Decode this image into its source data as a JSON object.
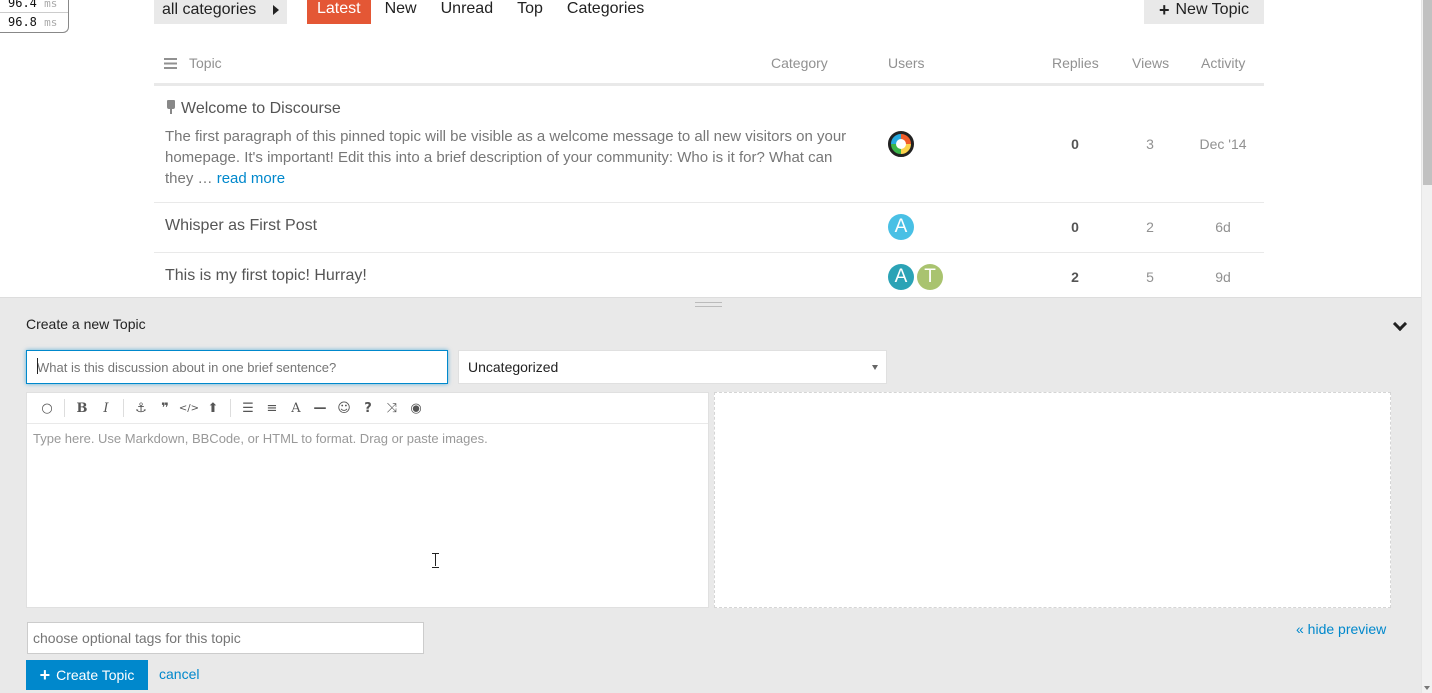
{
  "profiler": [
    {
      "value": "96.4",
      "unit": "ms"
    },
    {
      "value": "96.8",
      "unit": "ms"
    }
  ],
  "nav": {
    "category_dropdown": "all categories",
    "tabs": [
      "Latest",
      "New",
      "Unread",
      "Top",
      "Categories"
    ],
    "active_tab": "Latest",
    "new_topic_label": "New Topic"
  },
  "table": {
    "headers": {
      "topic": "Topic",
      "category": "Category",
      "users": "Users",
      "replies": "Replies",
      "views": "Views",
      "activity": "Activity"
    },
    "rows": [
      {
        "title": "Welcome to Discourse",
        "pinned": true,
        "excerpt": "The first paragraph of this pinned topic will be visible as a welcome message to all new visitors on your homepage. It's important! Edit this into a brief description of your community: Who is it for? What can they …",
        "read_more": "read more",
        "users": [
          "discourse-logo"
        ],
        "replies": "0",
        "views": "3",
        "activity": "Dec '14"
      },
      {
        "title": "Whisper as First Post",
        "users": [
          "A"
        ],
        "replies": "0",
        "views": "2",
        "activity": "6d"
      },
      {
        "title": "This is my first topic! Hurray!",
        "users": [
          "A",
          "T"
        ],
        "replies": "2",
        "views": "5",
        "activity": "9d"
      }
    ]
  },
  "composer": {
    "heading": "Create a new Topic",
    "title_placeholder": "What is this discussion about in one brief sentence?",
    "category": "Uncategorized",
    "editor_placeholder": "Type here. Use Markdown, BBCode, or HTML to format. Drag or paste images.",
    "toolbar_icons": [
      "speech-bubble-icon",
      "bold-icon",
      "italic-icon",
      "link-icon",
      "quote-icon",
      "code-icon",
      "upload-icon",
      "ordered-list-icon",
      "bullet-list-icon",
      "heading-icon",
      "horizontal-rule-icon",
      "emoji-icon",
      "help-icon",
      "shuffle-icon",
      "play-icon"
    ],
    "tags_placeholder": "choose optional tags for this topic",
    "hide_preview": "« hide preview",
    "create_label": "Create Topic",
    "cancel_label": "cancel"
  },
  "colors": {
    "accent": "#e45735",
    "link": "#0088cc",
    "composer_bg": "#e9e9e9"
  }
}
